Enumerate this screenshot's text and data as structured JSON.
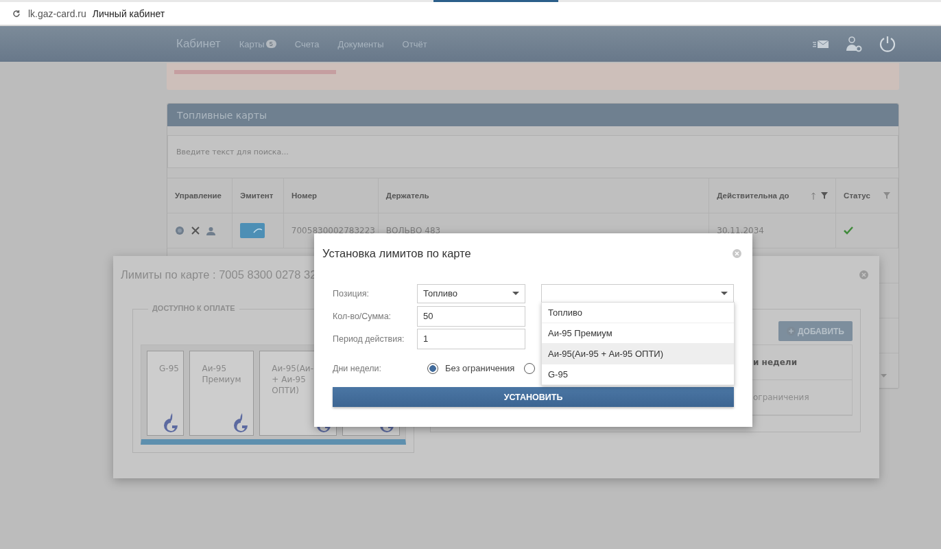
{
  "browser": {
    "url": "lk.gaz-card.ru",
    "page_title": "Личный кабинет"
  },
  "nav": {
    "brand": "Кабинет",
    "items": [
      {
        "label": "Карты",
        "badge": "5"
      },
      {
        "label": "Счета"
      },
      {
        "label": "Документы"
      },
      {
        "label": "Отчёт"
      }
    ]
  },
  "panel": {
    "title": "Топливные карты",
    "search": {
      "placeholder": "Введите текст для поиска..."
    },
    "table": {
      "columns": [
        {
          "label": "Управление"
        },
        {
          "label": "Эмитент"
        },
        {
          "label": "Номер"
        },
        {
          "label": "Держатель"
        },
        {
          "label": "Действительна до",
          "sortable": true,
          "filterable": true
        },
        {
          "label": "Статус",
          "filterable": true
        }
      ],
      "rows": [
        {
          "number": "7005830002783223",
          "holder": "ВОЛЬВО 483",
          "valid_until": "30.11.2034",
          "active": true
        }
      ]
    }
  },
  "limits_dialog": {
    "title": "Лимиты по карте : 7005 8300 0278 32",
    "legend": "ДОСТУПНО К ОПЛАТЕ",
    "fuel_tiles": [
      {
        "kind": "labeled",
        "label": "G-95"
      },
      {
        "kind": "labeled",
        "label": "Аи-95 Премиум"
      },
      {
        "kind": "labeled",
        "label": "Аи-95(Аи- + Аи-95 ОПТИ)"
      },
      {
        "kind": "logo_only"
      }
    ],
    "add_button": "ДОБАВИТЬ",
    "column": "и недели",
    "cell": "ограничения"
  },
  "set_limit_dialog": {
    "title": "Установка лимитов по карте",
    "fields": [
      {
        "kind": "select",
        "label": "Позиция:",
        "value": "Топливо"
      },
      {
        "kind": "input",
        "label": "Кол-во/Сумма:",
        "value": "50"
      },
      {
        "kind": "input",
        "label": "Период действия:",
        "value": "1"
      }
    ],
    "options": [
      {
        "label": "Топливо",
        "selected": false
      },
      {
        "label": "Аи-95 Премиум",
        "selected": false
      },
      {
        "label": "Аи-95(Аи-95 + Аи-95 ОПТИ)",
        "selected": true
      },
      {
        "label": "G-95",
        "selected": false
      }
    ],
    "weekdays": {
      "label": "Дни недели:",
      "options": [
        {
          "label": "Без ограничения",
          "selected": true
        },
        {
          "selected": false
        }
      ]
    },
    "submit": "УСТАНОВИТЬ"
  }
}
